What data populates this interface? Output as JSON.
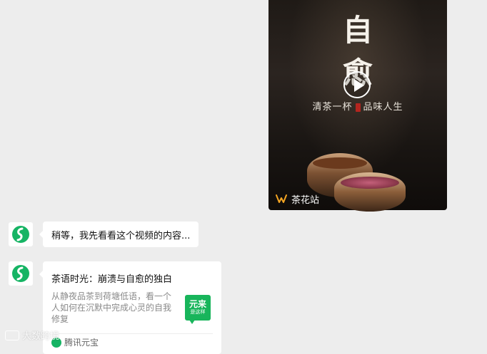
{
  "video_message": {
    "title_line1": "自",
    "title_line2": "愈",
    "slogan_left": "清茶一杯",
    "slogan_right": "品味人生",
    "channel_name": "茶花站",
    "icons": [
      "play-icon",
      "channel-logo-icon"
    ]
  },
  "bot": {
    "avatar_icon": "yuanbao-logo-icon"
  },
  "text_message": {
    "content": "稍等，我先看看这个视频的内容..."
  },
  "link_card": {
    "title": "茶语时光：崩溃与自愈的独白",
    "description": "从静夜品茶到荷塘低语，看一个人如何在沉默中完成心灵的自我修复",
    "thumbnail_line1": "元来",
    "thumbnail_line2": "是这样",
    "source": "腾讯元宝",
    "accent_color": "#18b55b"
  },
  "watermark": {
    "text": "大数跨境"
  }
}
